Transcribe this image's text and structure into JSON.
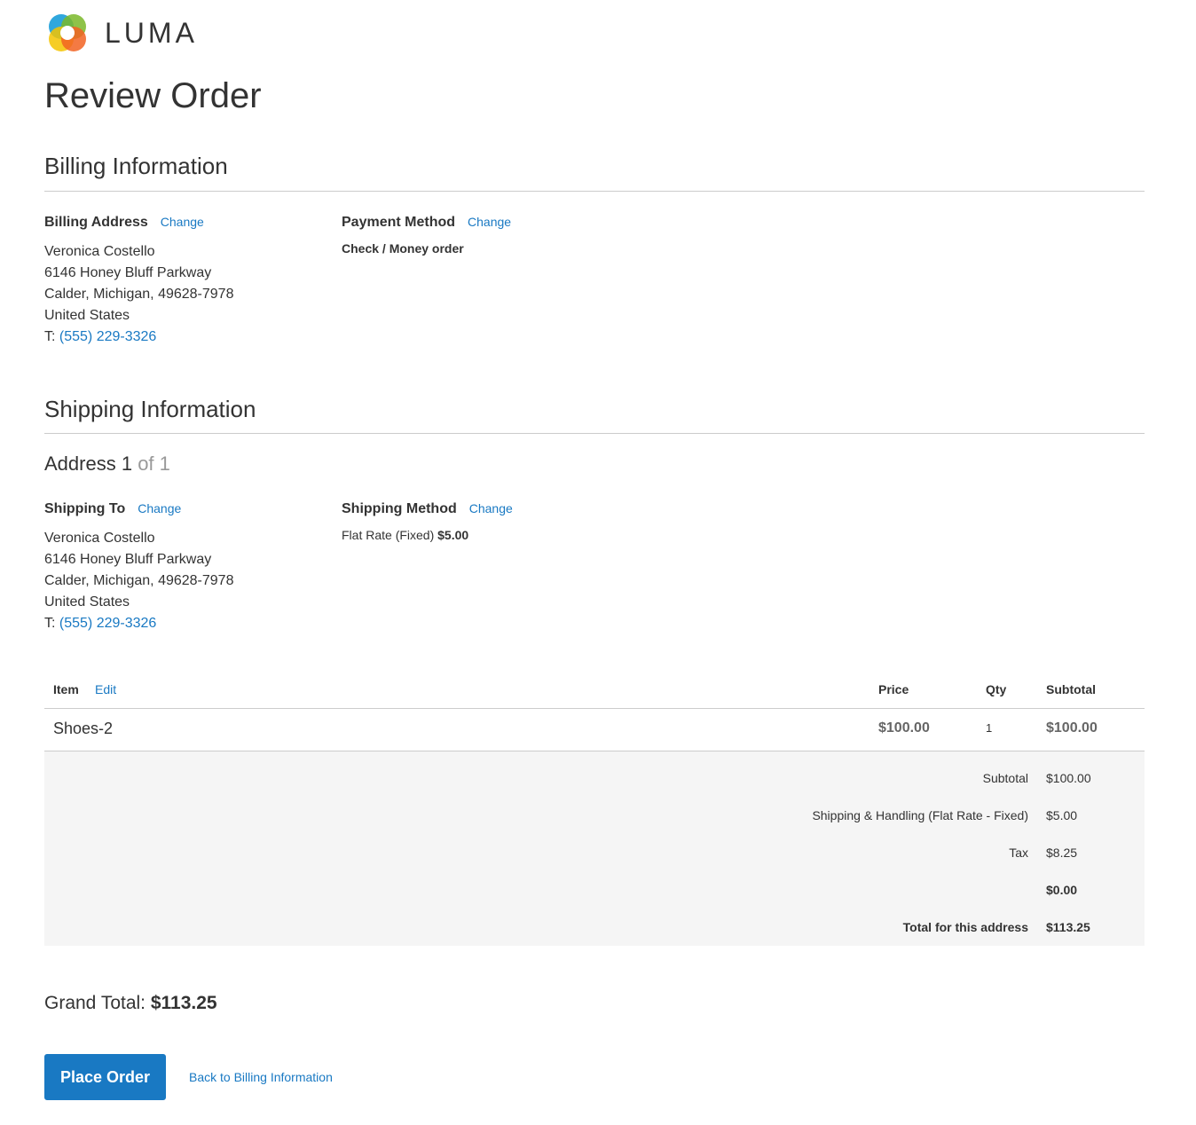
{
  "brand": {
    "name": "LUMA"
  },
  "page": {
    "title": "Review Order"
  },
  "billing": {
    "section_title": "Billing Information",
    "address_label": "Billing Address",
    "address_change": "Change",
    "address_lines": [
      "Veronica Costello",
      "6146 Honey Bluff Parkway",
      "Calder, Michigan, 49628-7978",
      "United States"
    ],
    "phone_prefix": "T: ",
    "phone": "(555) 229-3326",
    "payment_label": "Payment Method",
    "payment_change": "Change",
    "payment_method": "Check / Money order"
  },
  "shipping": {
    "section_title": "Shipping Information",
    "address_heading": "Address 1",
    "address_of": "of 1",
    "to_label": "Shipping To",
    "to_change": "Change",
    "address_lines": [
      "Veronica Costello",
      "6146 Honey Bluff Parkway",
      "Calder, Michigan, 49628-7978",
      "United States"
    ],
    "phone_prefix": "T: ",
    "phone": "(555) 229-3326",
    "method_label": "Shipping Method",
    "method_change": "Change",
    "method_text": "Flat Rate (Fixed)",
    "method_price": "$5.00"
  },
  "table": {
    "headers": {
      "item": "Item",
      "edit": "Edit",
      "price": "Price",
      "qty": "Qty",
      "subtotal": "Subtotal"
    },
    "rows": [
      {
        "name": "Shoes-2",
        "price": "$100.00",
        "qty": "1",
        "subtotal": "$100.00"
      }
    ]
  },
  "totals": [
    {
      "label": "Subtotal",
      "value": "$100.00"
    },
    {
      "label": "Shipping & Handling (Flat Rate - Fixed)",
      "value": "$5.00"
    },
    {
      "label": "Tax",
      "value": "$8.25"
    },
    {
      "label": "",
      "value": "$0.00"
    },
    {
      "label": "Total for this address",
      "value": "$113.25"
    }
  ],
  "grand_total": {
    "label": "Grand Total: ",
    "value": "$113.25"
  },
  "actions": {
    "place_order": "Place Order",
    "back_link": "Back to Billing Information"
  },
  "colors": {
    "link": "#1979c3",
    "primary_button": "#1979c3",
    "totals_bg": "#f5f5f5"
  }
}
